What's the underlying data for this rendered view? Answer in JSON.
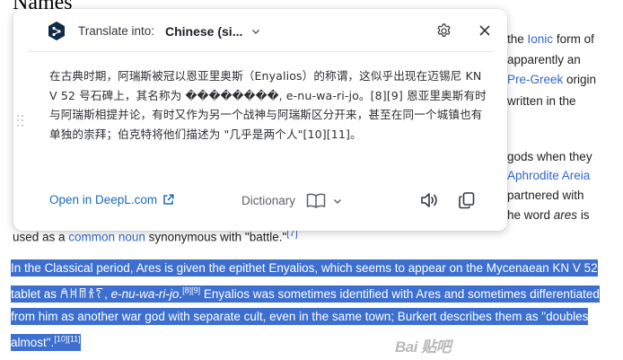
{
  "page": {
    "heading": "Names",
    "bg_right_lines": [
      {
        "before": "the ",
        "link": "Ionic",
        "after": " form of"
      },
      {
        "before": "apparently an",
        "link": "",
        "after": ""
      },
      {
        "before": "",
        "link": "Pre-Greek",
        "after": " origin"
      },
      {
        "before": "written in the",
        "link": "",
        "after": ""
      },
      {
        "before": "gods when they",
        "link": "",
        "after": ""
      },
      {
        "before": "",
        "link": "Aphrodite Areia",
        "after": ""
      },
      {
        "before": "partnered with",
        "link": "",
        "after": ""
      },
      {
        "before": "he word ",
        "link": "",
        "after": "is",
        "italic": "ares"
      }
    ],
    "bg_bottom": {
      "before": "used as a ",
      "link": "common noun",
      "after": " synonymous with \"battle.\"",
      "ref": "[7]"
    },
    "selected_paragraph": {
      "part1": "In the Classical period, Ares is given the epithet Enyalios, which seems to appear on the Mycenaean KN V 52 tablet as ",
      "linear_b": "𐀁𐀝𐀷𐀪𐀍",
      "translit": "e-nu-wa-ri-jo",
      "ref1": "[8][9]",
      "part2": " Enyalios was sometimes identified with Ares and sometimes differentiated from him as another war god with separate cult, even in the same town; Burkert describes them as \"doubles almost\".",
      "ref2": "[10][11]"
    },
    "watermark": "Bai  贴吧"
  },
  "popup": {
    "translate_into_label": "Translate into:",
    "target_language": "Chinese (si...",
    "translation_text": "在古典时期，阿瑞斯被冠以恩亚里奥斯（Enyalios）的称谓，这似乎出现在迈锡尼 KN V 52 号石碑上，其名称为 ��������, e-nu-wa-ri-jo。[8][9] 恩亚里奥斯有时与阿瑞斯相提并论，有时又作为另一个战神与阿瑞斯区分开来，甚至在同一个城镇也有单独的崇拜；伯克特将他们描述为 \"几乎是两个人\"[10][11]。",
    "open_in_deepl": "Open in DeepL.com",
    "dictionary": "Dictionary",
    "icons": {
      "logo": "deepl-logo-icon",
      "settings": "gear-icon",
      "close": "close-icon",
      "external": "external-link-icon",
      "dictionary": "book-icon",
      "speak": "speaker-icon",
      "copy": "copy-icon"
    },
    "colors": {
      "brand": "#0f2b46",
      "link": "#196bb6",
      "selection": "#3d6fcf"
    }
  }
}
